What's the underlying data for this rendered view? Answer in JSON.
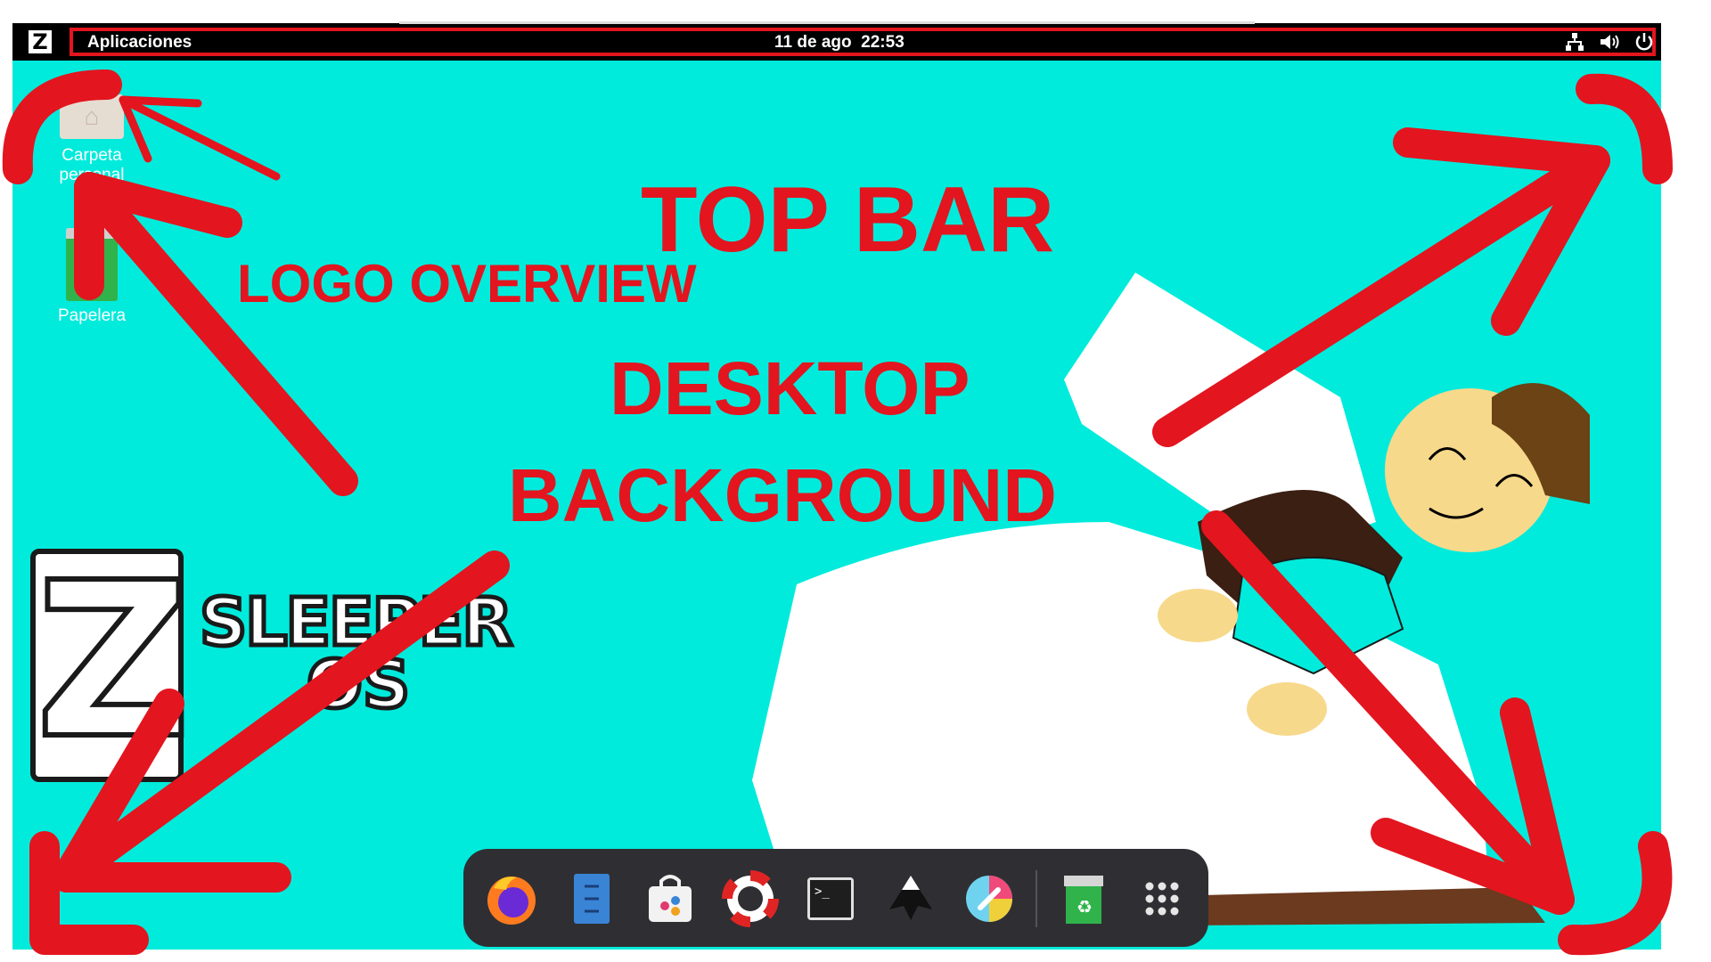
{
  "topbar": {
    "logo_letter": "Z",
    "applications_label": "Aplicaciones",
    "date": "11 de ago",
    "time": "22:53",
    "tray_icons": [
      "network-icon",
      "volume-icon",
      "power-icon"
    ]
  },
  "desktop": {
    "icons": [
      {
        "label": "Carpeta personal",
        "icon": "home-folder-icon"
      },
      {
        "label": "Papelera",
        "icon": "trash-icon"
      }
    ],
    "background_color": "#00ebdc"
  },
  "annotations": {
    "top_bar": "TOP BAR",
    "logo_overview": "LOGO OVERVIEW",
    "desktop": "DESKTOP",
    "background": "BACKGROUND",
    "color": "#e3151f"
  },
  "wallpaper": {
    "brand_letter": "Z",
    "brand_word_1": "SLEEPER",
    "brand_word_2": "OS"
  },
  "dock": {
    "items": [
      {
        "name": "firefox-icon"
      },
      {
        "name": "files-icon"
      },
      {
        "name": "software-store-icon"
      },
      {
        "name": "help-icon"
      },
      {
        "name": "terminal-icon"
      },
      {
        "name": "inkscape-icon"
      },
      {
        "name": "color-picker-icon"
      },
      {
        "name": "trash-dock-icon"
      },
      {
        "name": "app-grid-icon"
      }
    ]
  }
}
